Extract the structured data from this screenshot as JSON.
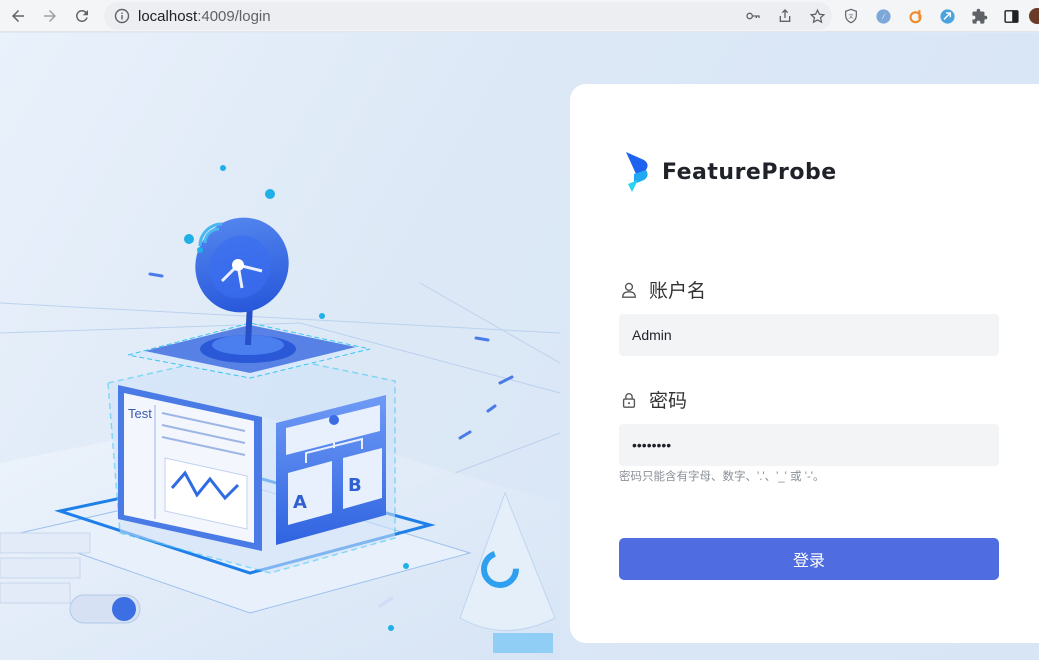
{
  "browser": {
    "url_host": "localhost",
    "url_rest": ":4009/login"
  },
  "login": {
    "brand": "FeatureProbe",
    "username_label": "账户名",
    "username_value": "Admin",
    "password_label": "密码",
    "password_value": "••••••••",
    "password_hint": "密码只能含有字母、数字、'.'、'_' 或 '-'。",
    "submit_label": "登录"
  },
  "illustration": {
    "test_label": "Test",
    "group_a": "A",
    "group_b": "B"
  },
  "colors": {
    "primary": "#4f6de0",
    "input_bg": "#f3f4f6",
    "page_bg": "#dfe9f6"
  }
}
